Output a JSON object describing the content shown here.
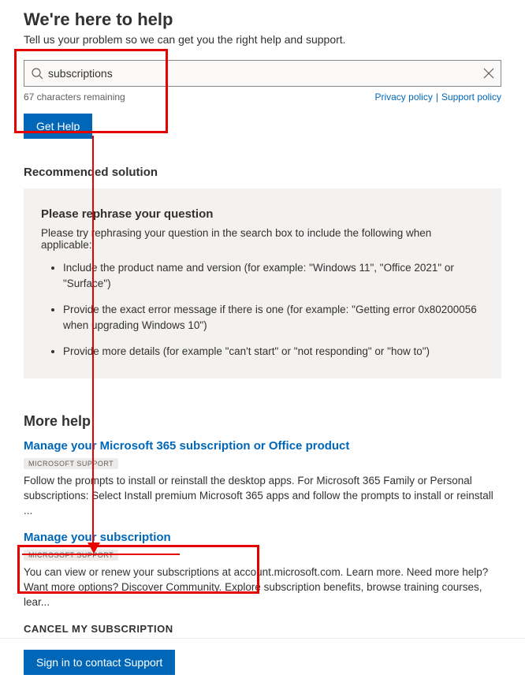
{
  "header": {
    "title": "We're here to help",
    "subtitle": "Tell us your problem so we can get you the right help and support."
  },
  "search": {
    "value": "subscriptions",
    "remaining": "67 characters remaining",
    "privacy": "Privacy policy",
    "support": "Support policy",
    "button": "Get Help"
  },
  "recommended": {
    "section": "Recommended solution",
    "heading": "Please rephrase your question",
    "lead": "Please try rephrasing your question in the search box to include the following when applicable:",
    "items": [
      "Include the product name and version (for example: \"Windows 11\", \"Office 2021\" or \"Surface\")",
      "Provide the exact error message if there is one (for example: \"Getting error 0x80200056 when upgrading Windows 10\")",
      "Provide more details (for example \"can't start\" or \"not responding\" or \"how to\")"
    ]
  },
  "more": {
    "title": "More help",
    "items": [
      {
        "title": "Manage your Microsoft 365 subscription or Office product",
        "badge": "MICROSOFT SUPPORT",
        "desc": "Follow the prompts to install or reinstall the desktop apps. For Microsoft 365 Family or Personal subscriptions: Select Install premium Microsoft 365 apps and follow the prompts to install or reinstall ..."
      },
      {
        "title": "Manage your subscription",
        "badge": "MICROSOFT SUPPORT",
        "desc": "You can view or renew your subscriptions at account.microsoft.com. Learn more. Need more help? Want more options? Discover Community. Explore subscription benefits, browse training courses, lear..."
      }
    ]
  },
  "annotation": {
    "struck": "CANCEL MY SUBSCRIPTION"
  },
  "footer": {
    "signin": "Sign in to contact Support"
  }
}
